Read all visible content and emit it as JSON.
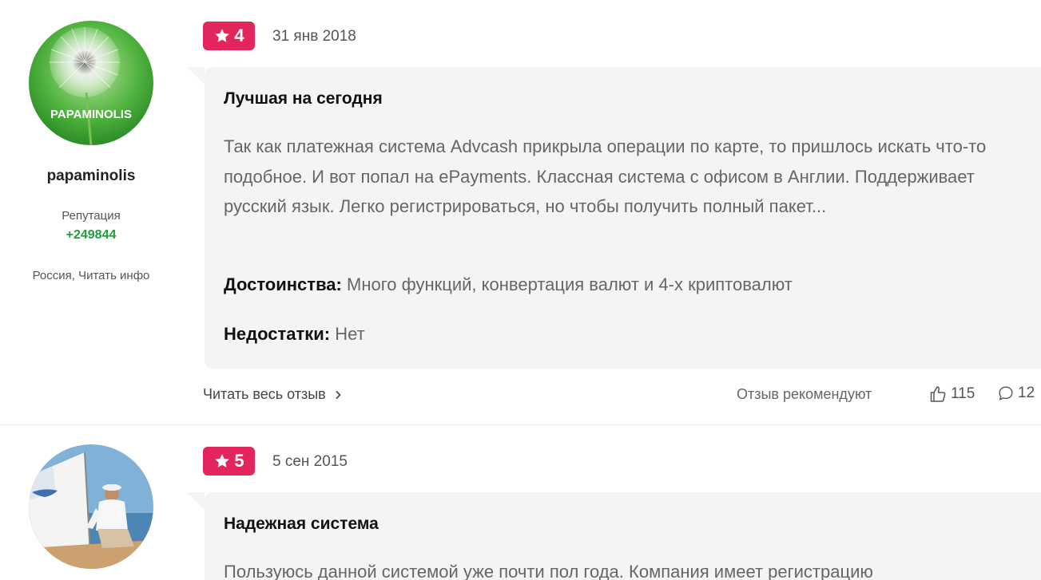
{
  "reviews": [
    {
      "author": {
        "name": "papaminolis",
        "avatar_text": "PAPAMINOLIS",
        "reputation_label": "Репутация",
        "reputation_value": "+249844",
        "location": "Россия, Читать инфо"
      },
      "rating": "4",
      "date": "31 янв 2018",
      "title": "Лучшая на сегодня",
      "text": "Так как платежная система Advcash прикрыла операции по карте, то пришлось искать что-то подобное. И вот попал на ePayments. Классная система с офисом в Англии. Поддерживает русский язык. Легко регистрироваться, но чтобы получить полный пакет...",
      "pros_label": "Достоинства:",
      "pros": "Много функций, конвертация валют и 4-х криптовалют",
      "cons_label": "Недостатки:",
      "cons": "Нет",
      "read_more": "Читать весь отзыв",
      "recommend_label": "Отзыв рекомендуют",
      "likes": "115",
      "comments": "12"
    },
    {
      "rating": "5",
      "date": "5 сен 2015",
      "title": "Надежная система",
      "text": "Пользуюсь данной системой уже почти пол года. Компания имеет регистрацию"
    }
  ],
  "colors": {
    "rating_badge": "#e2255b",
    "reputation_positive": "#1f9d3a",
    "card_bg": "#f3f4f6"
  }
}
